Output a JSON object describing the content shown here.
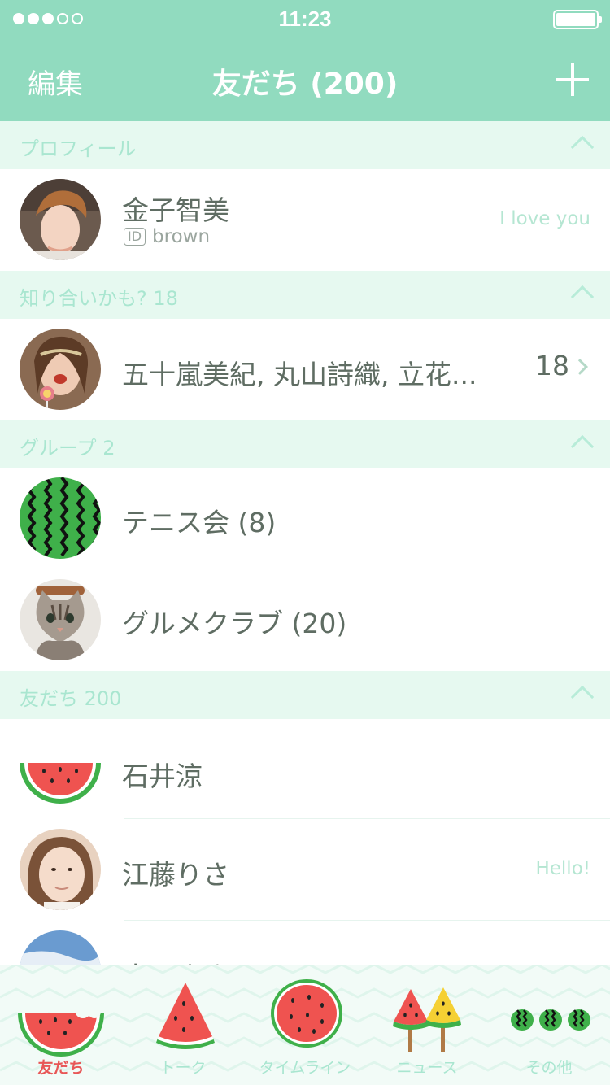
{
  "status_bar": {
    "time": "11:23"
  },
  "nav": {
    "edit_label": "編集",
    "title": "友だち (200)",
    "add_icon": "plus-icon"
  },
  "sections": {
    "profile": {
      "label": "プロフィール"
    },
    "suggested": {
      "label": "知り合いかも? 18"
    },
    "groups": {
      "label": "グループ 2"
    },
    "friends": {
      "label": "友だち 200"
    }
  },
  "profile": {
    "name": "金子智美",
    "id_badge": "ID",
    "id_value": "brown",
    "status": "I love you"
  },
  "suggested_row": {
    "names": "五十嵐美紀, 丸山詩織, 立花...",
    "count": "18"
  },
  "groups": [
    {
      "name": "テニス会 (8)"
    },
    {
      "name": "グルメクラブ (20)"
    }
  ],
  "friends": [
    {
      "name": "石井涼",
      "status": ""
    },
    {
      "name": "江藤りさ",
      "status": "Hello!"
    },
    {
      "name": "小田まさみ",
      "status": ""
    }
  ],
  "tabs": [
    {
      "label": "友だち",
      "icon": "watermelon-bitten-icon",
      "active": true
    },
    {
      "label": "トーク",
      "icon": "watermelon-slice-icon",
      "active": false
    },
    {
      "label": "タイムライン",
      "icon": "watermelon-round-icon",
      "active": false
    },
    {
      "label": "ニュース",
      "icon": "watermelon-popsicle-icon",
      "active": false
    },
    {
      "label": "その他",
      "icon": "watermelons-icon",
      "active": false
    }
  ],
  "colors": {
    "accent": "#91dbbf",
    "section_bg": "#e6f9f0",
    "text": "#5f6d63",
    "active_tab": "#e85757"
  }
}
